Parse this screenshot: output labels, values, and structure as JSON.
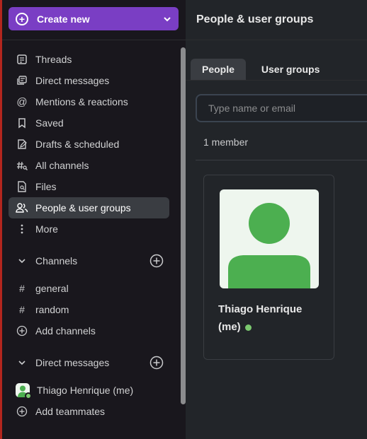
{
  "sidebar": {
    "create_label": "Create new",
    "nav": [
      {
        "label": "Threads",
        "icon": "threads-icon"
      },
      {
        "label": "Direct messages",
        "icon": "direct-messages-icon"
      },
      {
        "label": "Mentions & reactions",
        "icon": "at-sign-icon"
      },
      {
        "label": "Saved",
        "icon": "bookmark-icon"
      },
      {
        "label": "Drafts & scheduled",
        "icon": "draft-edit-icon"
      },
      {
        "label": "All channels",
        "icon": "browse-channels-icon"
      },
      {
        "label": "Files",
        "icon": "files-icon"
      },
      {
        "label": "People & user groups",
        "icon": "people-icon",
        "active": true
      },
      {
        "label": "More",
        "icon": "more-vertical-icon"
      }
    ],
    "channels_section": {
      "label": "Channels",
      "items": [
        {
          "label": "general"
        },
        {
          "label": "random"
        }
      ],
      "add_label": "Add channels"
    },
    "dm_section": {
      "label": "Direct messages",
      "items": [
        {
          "label": "Thiago Henrique (me)"
        }
      ],
      "add_label": "Add teammates"
    }
  },
  "main": {
    "title": "People & user groups",
    "tabs": [
      {
        "label": "People",
        "active": true
      },
      {
        "label": "User groups",
        "active": false
      }
    ],
    "search_placeholder": "Type name or email",
    "member_count": "1 member",
    "members": [
      {
        "name": "Thiago Henrique (me)",
        "status": "online"
      }
    ]
  },
  "colors": {
    "accent": "#7a3ec4",
    "sidebar_bg": "#19171d",
    "main_bg": "#222529",
    "online": "#7bc96f",
    "avatar_green": "#4caf50"
  }
}
